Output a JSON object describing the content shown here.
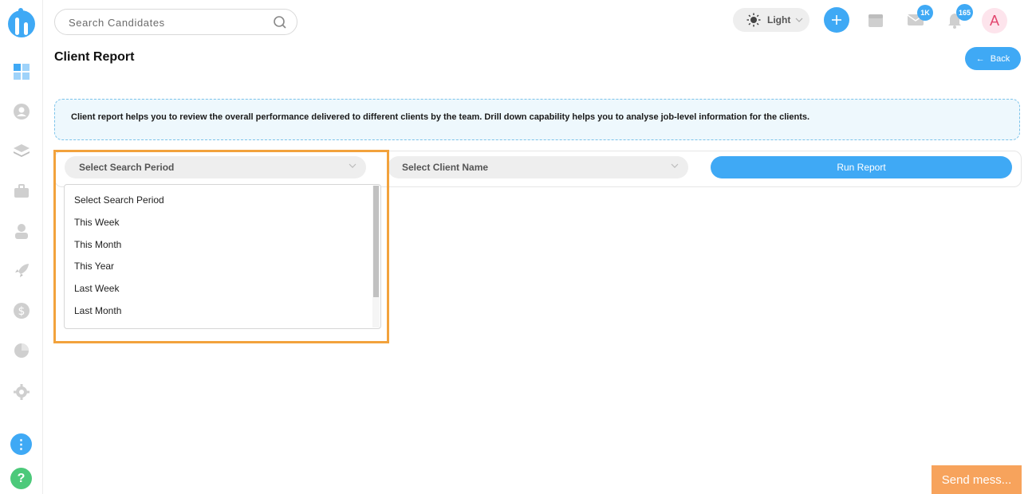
{
  "header": {
    "search_placeholder": "Search Candidates",
    "theme_label": "Light",
    "mail_badge": "1K",
    "notification_badge": "165",
    "avatar_initial": "A"
  },
  "page": {
    "title": "Client Report",
    "back_label": "Back",
    "info_text": "Client report helps you to review the overall performance delivered to different clients by the team. Drill down capability helps you to analyse job-level information for the clients."
  },
  "filters": {
    "period_selected": "Select Search Period",
    "client_selected": "Select Client Name",
    "run_label": "Run Report",
    "period_options": [
      "Select Search Period",
      "This Week",
      "This Month",
      "This Year",
      "Last Week",
      "Last Month"
    ]
  },
  "sidebar": {
    "more_label": "⋮",
    "help_label": "?"
  },
  "chat": {
    "send_label": "Send mess..."
  },
  "colors": {
    "accent": "#3fa9f5",
    "highlight": "#f2a23c",
    "chat": "#f7a35c"
  }
}
